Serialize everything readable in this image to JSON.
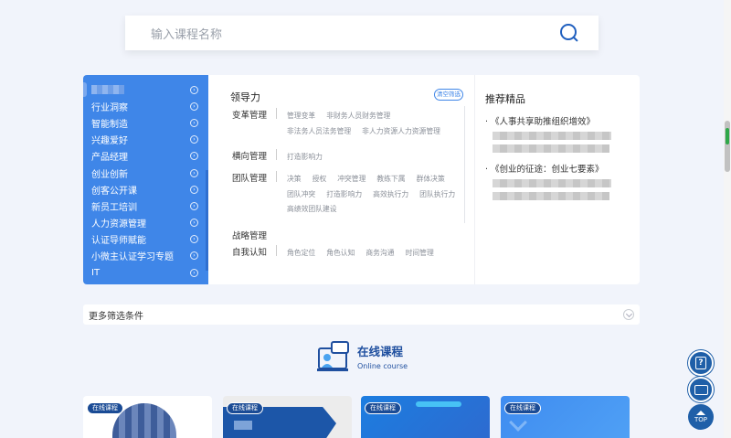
{
  "search": {
    "placeholder": "输入课程名称"
  },
  "sidebar": {
    "items": [
      {
        "label": ""
      },
      {
        "label": "行业洞察"
      },
      {
        "label": "智能制造"
      },
      {
        "label": "兴趣爱好"
      },
      {
        "label": "产品经理"
      },
      {
        "label": "创业创新"
      },
      {
        "label": "创客公开课"
      },
      {
        "label": "新员工培训"
      },
      {
        "label": "人力资源管理"
      },
      {
        "label": "认证导师赋能"
      },
      {
        "label": "小微主认证学习专题"
      },
      {
        "label": "IT"
      }
    ]
  },
  "filter": {
    "category": "领导力",
    "clear_label": "清空筛选",
    "rows": [
      {
        "name": "变革管理",
        "tags": [
          "管理变革",
          "非财务人员财务管理",
          "非法务人员法务管理",
          "非人力资源人力资源管理"
        ]
      },
      {
        "name": "横向管理",
        "tags": [
          "打造影响力"
        ]
      },
      {
        "name": "团队管理",
        "tags": [
          "决策",
          "授权",
          "冲突管理",
          "教练下属",
          "群体决策",
          "团队冲突",
          "打造影响力",
          "高效执行力",
          "团队执行力",
          "高绩效团队建设"
        ]
      },
      {
        "name": "战略管理",
        "tags": []
      },
      {
        "name": "自我认知",
        "tags": [
          "角色定位",
          "角色认知",
          "商务沟通",
          "时间管理"
        ]
      }
    ]
  },
  "recommend": {
    "title": "推荐精品",
    "items": [
      {
        "title": "《人事共享助推组织增效》"
      },
      {
        "title": "《创业的征途：创业七要素》"
      }
    ]
  },
  "more_filters": {
    "label": "更多筛选条件"
  },
  "section": {
    "title": "在线课程",
    "subtitle": "Online course"
  },
  "cards": [
    {
      "badge": "在线课程"
    },
    {
      "badge": "在线课程"
    },
    {
      "badge": "在线课程"
    },
    {
      "badge": "在线课程"
    }
  ],
  "float": {
    "top_label": "TOP"
  },
  "colors": {
    "accent": "#3f86e8",
    "brand_dark": "#1f5fa8",
    "background": "#f1f4fb"
  }
}
